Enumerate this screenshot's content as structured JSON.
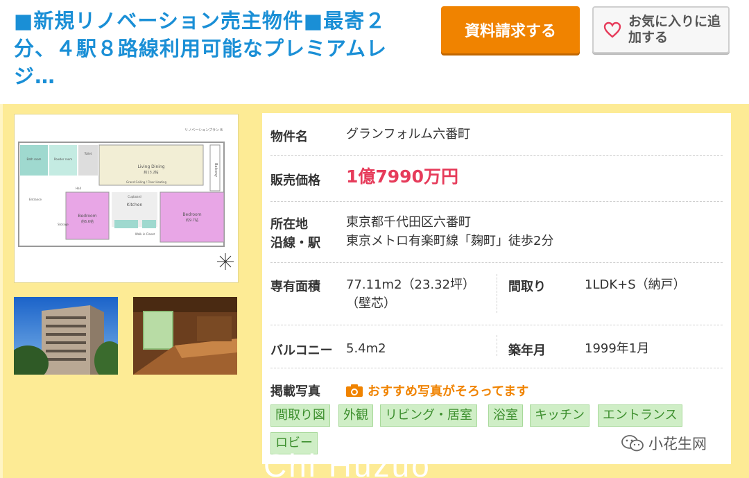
{
  "listing": {
    "title": "■新規リノベーション売主物件■最寄２分、４駅８路線利用可能なプレミアムレジ…",
    "request_button": "資料請求する",
    "favorite_button": "お気に入りに追加する",
    "floorplan_caption": "リノベーションプラン B",
    "floorplan_rooms": {
      "living": "Living Dining",
      "living_size": "約13.2帖",
      "ceiling": "Grand Ceiling / Floor Heating",
      "bedroom1": "Bedroom",
      "bedroom1_size": "約6.6帖",
      "bedroom2": "Bedroom",
      "bedroom2_size": "約9.7帖",
      "kitchen": "Kitchen",
      "bath": "Bath room",
      "powder": "Powder room",
      "toilet": "Toilet",
      "hall": "Hall",
      "entrance": "Entrance",
      "storage": "Storage",
      "cupboard": "Cupboard",
      "walkin": "Walk in Closet",
      "balcony": "Balcony"
    }
  },
  "details": {
    "name_label": "物件名",
    "name_value": "グランフォルム六番町",
    "price_label": "販売価格",
    "price_value": "1億7990万円",
    "address_label": "所在地",
    "address_value": "東京都千代田区六番町",
    "station_label": "沿線・駅",
    "station_value": "東京メトロ有楽町線「麹町」徒歩2分",
    "area_label": "専有面積",
    "area_value": "77.11m2（23.32坪）（壁芯）",
    "layout_label": "間取り",
    "layout_value": "1LDK+S（納戸）",
    "balcony_label": "バルコニー",
    "balcony_value": "5.4m2",
    "built_label": "築年月",
    "built_value": "1999年1月",
    "photos_label": "掲載写真",
    "photos_note": "おすすめ写真がそろってます"
  },
  "photo_tags": [
    "間取り図",
    "外観",
    "リビング・居室",
    "浴室",
    "キッチン",
    "エントランス",
    "ロビー"
  ],
  "watermark": "小花生网",
  "overlay_text": "Chi Huzuo",
  "colors": {
    "title": "#1a8fd6",
    "request_button": "#f08300",
    "price": "#e63b5a",
    "tag_bg": "#cfeec6",
    "tag_text": "#3d8f2e",
    "panel_bg": "#fdeb95"
  }
}
